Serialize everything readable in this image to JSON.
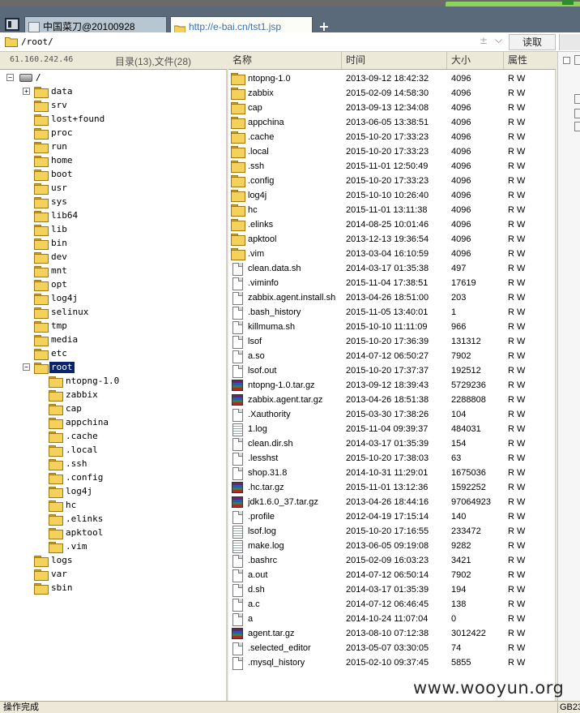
{
  "tabs": [
    {
      "label": "中国菜刀@20100928",
      "active": false
    },
    {
      "label": "http://e-bai.cn/tst1.jsp",
      "active": true
    }
  ],
  "new_tab_label": "+",
  "address": {
    "path": "/root/",
    "glyph": "±",
    "read_label": "读取"
  },
  "left_header": {
    "ip": "61.160.242.46",
    "counts": "目录(13),文件(28)"
  },
  "columns": {
    "name": "名称",
    "time": "时间",
    "size": "大小",
    "attr": "属性"
  },
  "tree": [
    {
      "label": "/",
      "depth": 0,
      "type": "drive",
      "expander": "-"
    },
    {
      "label": "data",
      "depth": 1,
      "type": "folder",
      "expander": "+"
    },
    {
      "label": "srv",
      "depth": 1,
      "type": "folder",
      "expander": ""
    },
    {
      "label": "lost+found",
      "depth": 1,
      "type": "folder",
      "expander": ""
    },
    {
      "label": "proc",
      "depth": 1,
      "type": "folder",
      "expander": ""
    },
    {
      "label": "run",
      "depth": 1,
      "type": "folder",
      "expander": ""
    },
    {
      "label": "home",
      "depth": 1,
      "type": "folder",
      "expander": ""
    },
    {
      "label": "boot",
      "depth": 1,
      "type": "folder",
      "expander": ""
    },
    {
      "label": "usr",
      "depth": 1,
      "type": "folder",
      "expander": ""
    },
    {
      "label": "sys",
      "depth": 1,
      "type": "folder",
      "expander": ""
    },
    {
      "label": "lib64",
      "depth": 1,
      "type": "folder",
      "expander": ""
    },
    {
      "label": "lib",
      "depth": 1,
      "type": "folder",
      "expander": ""
    },
    {
      "label": "bin",
      "depth": 1,
      "type": "folder",
      "expander": ""
    },
    {
      "label": "dev",
      "depth": 1,
      "type": "folder",
      "expander": ""
    },
    {
      "label": "mnt",
      "depth": 1,
      "type": "folder",
      "expander": ""
    },
    {
      "label": "opt",
      "depth": 1,
      "type": "folder",
      "expander": ""
    },
    {
      "label": "log4j",
      "depth": 1,
      "type": "folder",
      "expander": ""
    },
    {
      "label": "selinux",
      "depth": 1,
      "type": "folder",
      "expander": ""
    },
    {
      "label": "tmp",
      "depth": 1,
      "type": "folder",
      "expander": ""
    },
    {
      "label": "media",
      "depth": 1,
      "type": "folder",
      "expander": ""
    },
    {
      "label": "etc",
      "depth": 1,
      "type": "folder",
      "expander": ""
    },
    {
      "label": "root",
      "depth": 1,
      "type": "folder",
      "expander": "-",
      "selected": true
    },
    {
      "label": "ntopng-1.0",
      "depth": 2,
      "type": "folder",
      "expander": ""
    },
    {
      "label": "zabbix",
      "depth": 2,
      "type": "folder",
      "expander": ""
    },
    {
      "label": "cap",
      "depth": 2,
      "type": "folder",
      "expander": ""
    },
    {
      "label": "appchina",
      "depth": 2,
      "type": "folder",
      "expander": ""
    },
    {
      "label": ".cache",
      "depth": 2,
      "type": "folder",
      "expander": ""
    },
    {
      "label": ".local",
      "depth": 2,
      "type": "folder",
      "expander": ""
    },
    {
      "label": ".ssh",
      "depth": 2,
      "type": "folder",
      "expander": ""
    },
    {
      "label": ".config",
      "depth": 2,
      "type": "folder",
      "expander": ""
    },
    {
      "label": "log4j",
      "depth": 2,
      "type": "folder",
      "expander": ""
    },
    {
      "label": "hc",
      "depth": 2,
      "type": "folder",
      "expander": ""
    },
    {
      "label": ".elinks",
      "depth": 2,
      "type": "folder",
      "expander": ""
    },
    {
      "label": "apktool",
      "depth": 2,
      "type": "folder",
      "expander": ""
    },
    {
      "label": ".vim",
      "depth": 2,
      "type": "folder",
      "expander": ""
    },
    {
      "label": "logs",
      "depth": 1,
      "type": "folder",
      "expander": ""
    },
    {
      "label": "var",
      "depth": 1,
      "type": "folder",
      "expander": ""
    },
    {
      "label": "sbin",
      "depth": 1,
      "type": "folder",
      "expander": ""
    }
  ],
  "files": [
    {
      "name": "ntopng-1.0",
      "time": "2013-09-12 18:42:32",
      "size": "4096",
      "attr": "R W",
      "icon": "folder"
    },
    {
      "name": "zabbix",
      "time": "2015-02-09 14:58:30",
      "size": "4096",
      "attr": "R W",
      "icon": "folder"
    },
    {
      "name": "cap",
      "time": "2013-09-13 12:34:08",
      "size": "4096",
      "attr": "R W",
      "icon": "folder"
    },
    {
      "name": "appchina",
      "time": "2013-06-05 13:38:51",
      "size": "4096",
      "attr": "R W",
      "icon": "folder"
    },
    {
      "name": ".cache",
      "time": "2015-10-20 17:33:23",
      "size": "4096",
      "attr": "R W",
      "icon": "folder"
    },
    {
      "name": ".local",
      "time": "2015-10-20 17:33:23",
      "size": "4096",
      "attr": "R W",
      "icon": "folder"
    },
    {
      "name": ".ssh",
      "time": "2015-11-01 12:50:49",
      "size": "4096",
      "attr": "R W",
      "icon": "folder"
    },
    {
      "name": ".config",
      "time": "2015-10-20 17:33:23",
      "size": "4096",
      "attr": "R W",
      "icon": "folder"
    },
    {
      "name": "log4j",
      "time": "2015-10-10 10:26:40",
      "size": "4096",
      "attr": "R W",
      "icon": "folder"
    },
    {
      "name": "hc",
      "time": "2015-11-01 13:11:38",
      "size": "4096",
      "attr": "R W",
      "icon": "folder"
    },
    {
      "name": ".elinks",
      "time": "2014-08-25 10:01:46",
      "size": "4096",
      "attr": "R W",
      "icon": "folder"
    },
    {
      "name": "apktool",
      "time": "2013-12-13 19:36:54",
      "size": "4096",
      "attr": "R W",
      "icon": "folder"
    },
    {
      "name": ".vim",
      "time": "2013-03-04 16:10:59",
      "size": "4096",
      "attr": "R W",
      "icon": "folder"
    },
    {
      "name": "clean.data.sh",
      "time": "2014-03-17 01:35:38",
      "size": "497",
      "attr": "R W",
      "icon": "file"
    },
    {
      "name": ".viminfo",
      "time": "2015-11-04 17:38:51",
      "size": "17619",
      "attr": "R W",
      "icon": "file"
    },
    {
      "name": "zabbix.agent.install.sh",
      "time": "2013-04-26 18:51:00",
      "size": "203",
      "attr": "R W",
      "icon": "file"
    },
    {
      "name": ".bash_history",
      "time": "2015-11-05 13:40:01",
      "size": "1",
      "attr": "R W",
      "icon": "file"
    },
    {
      "name": "killmuma.sh",
      "time": "2015-10-10 11:11:09",
      "size": "966",
      "attr": "R W",
      "icon": "file"
    },
    {
      "name": "lsof",
      "time": "2015-10-20 17:36:39",
      "size": "131312",
      "attr": "R W",
      "icon": "file"
    },
    {
      "name": "a.so",
      "time": "2014-07-12 06:50:27",
      "size": "7902",
      "attr": "R W",
      "icon": "file"
    },
    {
      "name": "lsof.out",
      "time": "2015-10-20 17:37:37",
      "size": "192512",
      "attr": "R W",
      "icon": "file"
    },
    {
      "name": "ntopng-1.0.tar.gz",
      "time": "2013-09-12 18:39:43",
      "size": "5729236",
      "attr": "R W",
      "icon": "archive"
    },
    {
      "name": "zabbix.agent.tar.gz",
      "time": "2013-04-26 18:51:38",
      "size": "2288808",
      "attr": "R W",
      "icon": "archive"
    },
    {
      "name": ".Xauthority",
      "time": "2015-03-30 17:38:26",
      "size": "104",
      "attr": "R W",
      "icon": "file"
    },
    {
      "name": "1.log",
      "time": "2015-11-04 09:39:37",
      "size": "484031",
      "attr": "R W",
      "icon": "text"
    },
    {
      "name": "clean.dir.sh",
      "time": "2014-03-17 01:35:39",
      "size": "154",
      "attr": "R W",
      "icon": "file"
    },
    {
      "name": ".lesshst",
      "time": "2015-10-20 17:38:03",
      "size": "63",
      "attr": "R W",
      "icon": "file"
    },
    {
      "name": "shop.31.8",
      "time": "2014-10-31 11:29:01",
      "size": "1675036",
      "attr": "R W",
      "icon": "file"
    },
    {
      "name": ".hc.tar.gz",
      "time": "2015-11-01 13:12:36",
      "size": "1592252",
      "attr": "R W",
      "icon": "archive"
    },
    {
      "name": "jdk1.6.0_37.tar.gz",
      "time": "2013-04-26 18:44:16",
      "size": "97064923",
      "attr": "R W",
      "icon": "archive"
    },
    {
      "name": ".profile",
      "time": "2012-04-19 17:15:14",
      "size": "140",
      "attr": "R W",
      "icon": "file"
    },
    {
      "name": "lsof.log",
      "time": "2015-10-20 17:16:55",
      "size": "233472",
      "attr": "R W",
      "icon": "text"
    },
    {
      "name": "make.log",
      "time": "2013-06-05 09:19:08",
      "size": "9282",
      "attr": "R W",
      "icon": "text"
    },
    {
      "name": ".bashrc",
      "time": "2015-02-09 16:03:23",
      "size": "3421",
      "attr": "R W",
      "icon": "file"
    },
    {
      "name": "a.out",
      "time": "2014-07-12 06:50:14",
      "size": "7902",
      "attr": "R W",
      "icon": "file"
    },
    {
      "name": "d.sh",
      "time": "2014-03-17 01:35:39",
      "size": "194",
      "attr": "R W",
      "icon": "file"
    },
    {
      "name": "a.c",
      "time": "2014-07-12 06:46:45",
      "size": "138",
      "attr": "R W",
      "icon": "file"
    },
    {
      "name": "a",
      "time": "2014-10-24 11:07:04",
      "size": "0",
      "attr": "R W",
      "icon": "file"
    },
    {
      "name": "agent.tar.gz",
      "time": "2013-08-10 07:12:38",
      "size": "3012422",
      "attr": "R W",
      "icon": "archive"
    },
    {
      "name": ".selected_editor",
      "time": "2013-05-07 03:30:05",
      "size": "74",
      "attr": "R W",
      "icon": "file"
    },
    {
      "name": ".mysql_history",
      "time": "2015-02-10 09:37:45",
      "size": "5855",
      "attr": "R W",
      "icon": "file"
    }
  ],
  "status": {
    "text": "操作完成",
    "encoding": "GB23"
  },
  "watermark": "www.wooyun.org",
  "colors": {
    "selection": "#0a246a",
    "folder": "#f3d15a",
    "url_tab_text": "#3b6fb6"
  }
}
